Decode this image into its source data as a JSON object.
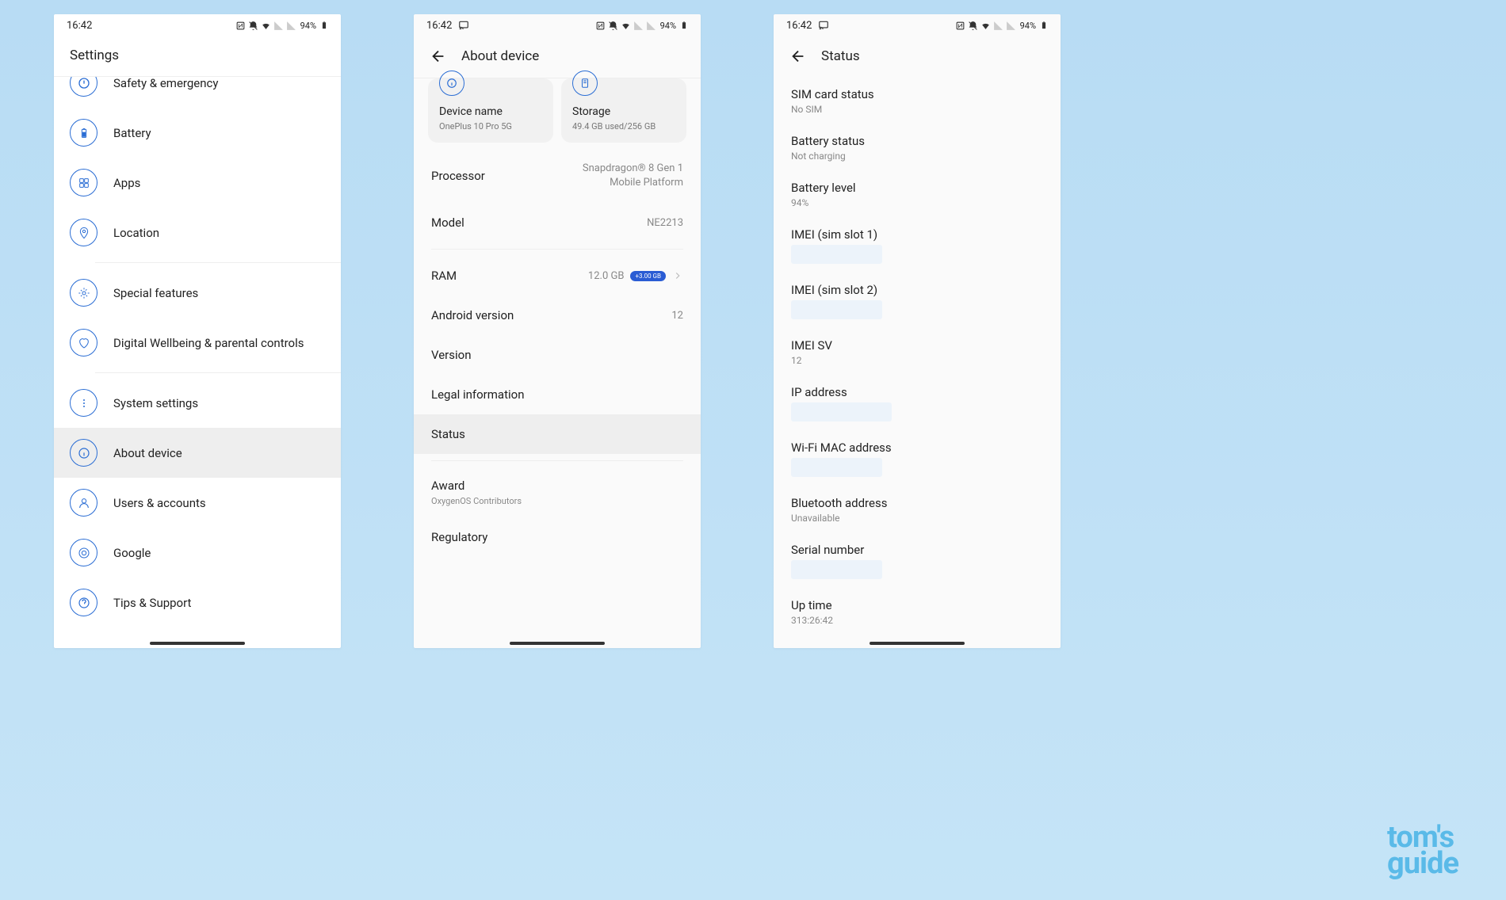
{
  "status_bar": {
    "time": "16:42",
    "battery_pct": "94%"
  },
  "screen1": {
    "title": "Settings",
    "items": [
      {
        "icon": "safety",
        "label": "Safety & emergency"
      },
      {
        "icon": "battery",
        "label": "Battery"
      },
      {
        "icon": "apps",
        "label": "Apps"
      },
      {
        "icon": "location",
        "label": "Location"
      },
      {
        "icon": "special",
        "label": "Special features"
      },
      {
        "icon": "wellbeing",
        "label": "Digital Wellbeing & parental controls"
      },
      {
        "icon": "system",
        "label": "System settings"
      },
      {
        "icon": "about",
        "label": "About device"
      },
      {
        "icon": "users",
        "label": "Users & accounts"
      },
      {
        "icon": "google",
        "label": "Google"
      },
      {
        "icon": "tips",
        "label": "Tips & Support"
      }
    ]
  },
  "screen2": {
    "title": "About device",
    "card1": {
      "title": "Device name",
      "subtitle": "OnePlus 10 Pro 5G"
    },
    "card2": {
      "title": "Storage",
      "subtitle": "49.4 GB used/256 GB"
    },
    "rows": {
      "processor": {
        "label": "Processor",
        "value": "Snapdragon® 8 Gen 1 Mobile Platform"
      },
      "model": {
        "label": "Model",
        "value": "NE2213"
      },
      "ram": {
        "label": "RAM",
        "value": "12.0 GB",
        "badge": "+3.00 GB"
      },
      "android": {
        "label": "Android version",
        "value": "12"
      },
      "version": {
        "label": "Version"
      },
      "legal": {
        "label": "Legal information"
      },
      "status": {
        "label": "Status"
      },
      "award": {
        "label": "Award",
        "sub": "OxygenOS Contributors"
      },
      "regulatory": {
        "label": "Regulatory"
      }
    }
  },
  "screen3": {
    "title": "Status",
    "items": {
      "sim": {
        "label": "SIM card status",
        "value": "No SIM"
      },
      "batt_status": {
        "label": "Battery status",
        "value": "Not charging"
      },
      "batt_level": {
        "label": "Battery level",
        "value": "94%"
      },
      "imei1": {
        "label": "IMEI (sim slot 1)"
      },
      "imei2": {
        "label": "IMEI (sim slot 2)"
      },
      "imei_sv": {
        "label": "IMEI SV",
        "value": "12"
      },
      "ip": {
        "label": "IP address"
      },
      "wifi_mac": {
        "label": "Wi-Fi MAC address"
      },
      "bt": {
        "label": "Bluetooth address",
        "value": "Unavailable"
      },
      "serial": {
        "label": "Serial number"
      },
      "uptime": {
        "label": "Up time",
        "value": "313:26:42"
      }
    }
  },
  "watermark": {
    "line1": "tom's",
    "line2": "guide"
  }
}
